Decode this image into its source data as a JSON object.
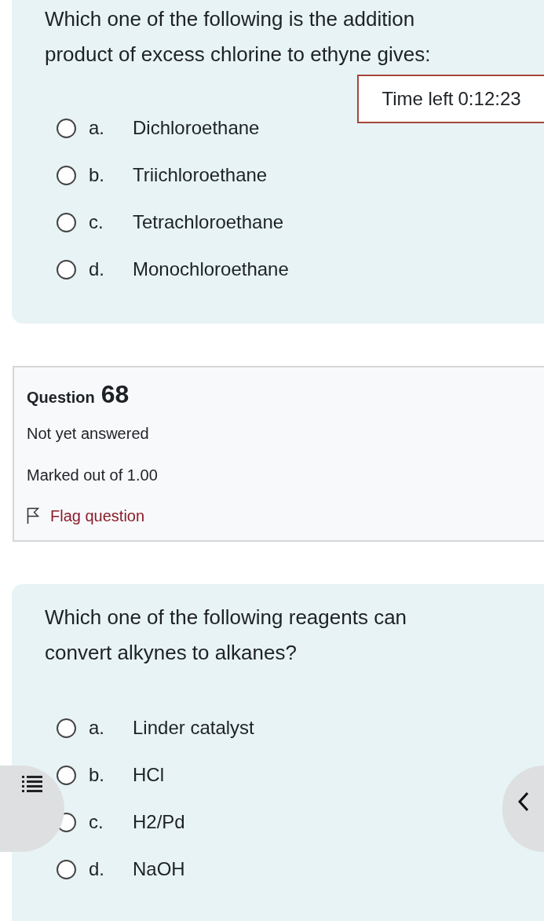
{
  "question_67": {
    "text": "Which one of the following is the addition product of excess chlorine to ethyne gives:",
    "options": [
      {
        "letter": "a.",
        "text": "Dichloroethane",
        "selected": false
      },
      {
        "letter": "b.",
        "text": "Triichloroethane",
        "selected": false
      },
      {
        "letter": "c.",
        "text": "Tetrachloroethane",
        "selected": false
      },
      {
        "letter": "d.",
        "text": "Monochloroethane",
        "selected": false
      }
    ]
  },
  "timer": {
    "label": "Time left",
    "value": "0:12:23"
  },
  "question_68_info": {
    "label": "Question",
    "number": "68",
    "state": "Not yet answered",
    "marks": "Marked out of 1.00",
    "flag": {
      "label": "Flag question",
      "flagged": false
    }
  },
  "question_68": {
    "text": "Which one of the following reagents can convert alkynes to alkanes?",
    "options": [
      {
        "letter": "a.",
        "text": "Linder catalyst",
        "selected": false
      },
      {
        "letter": "b.",
        "text": "HCl",
        "selected": false
      },
      {
        "letter": "c.",
        "text": "H2/Pd",
        "selected": false
      },
      {
        "letter": "d.",
        "text": "NaOH",
        "selected": false
      }
    ]
  }
}
